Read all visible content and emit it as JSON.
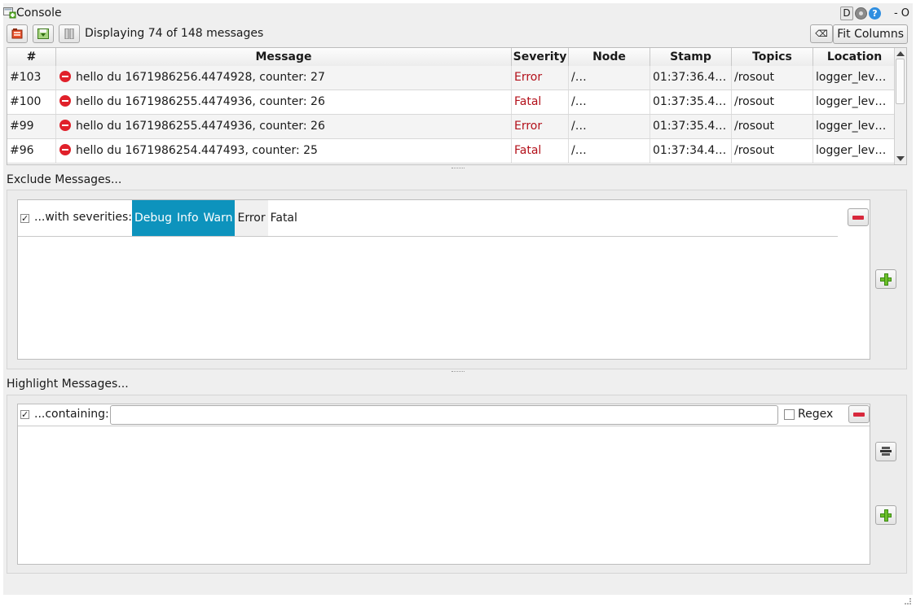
{
  "window": {
    "title": "Console",
    "title_buttons": {
      "d_label": "D",
      "help_label": "?",
      "controls_text": "- O"
    }
  },
  "toolbar": {
    "status": "Displaying 74 of 148 messages",
    "fit_columns_label": "Fit Columns",
    "clear_label": "⌫"
  },
  "table": {
    "columns": [
      "#",
      "Message",
      "Severity",
      "Node",
      "Stamp",
      "Topics",
      "Location"
    ],
    "rows": [
      {
        "num": "#103",
        "message": "hello du 1671986256.4474928, counter: 27",
        "severity": "Error",
        "node": "/…",
        "stamp": "01:37:36.4…",
        "topics": "/rosout",
        "location": "logger_lev…"
      },
      {
        "num": "#100",
        "message": "hello du 1671986255.4474936, counter: 26",
        "severity": "Fatal",
        "node": "/…",
        "stamp": "01:37:35.4…",
        "topics": "/rosout",
        "location": "logger_lev…"
      },
      {
        "num": "#99",
        "message": "hello du 1671986255.4474936, counter: 26",
        "severity": "Error",
        "node": "/…",
        "stamp": "01:37:35.4…",
        "topics": "/rosout",
        "location": "logger_lev…"
      },
      {
        "num": "#96",
        "message": "hello du 1671986254.447493, counter: 25",
        "severity": "Fatal",
        "node": "/…",
        "stamp": "01:37:34.4…",
        "topics": "/rosout",
        "location": "logger_lev…"
      }
    ]
  },
  "exclude": {
    "title": "Exclude Messages...",
    "filter": {
      "checked": true,
      "label": "...with severities:",
      "severities": [
        {
          "name": "Debug",
          "selected": true
        },
        {
          "name": "Info",
          "selected": true
        },
        {
          "name": "Warn",
          "selected": true
        },
        {
          "name": "Error",
          "selected": false
        },
        {
          "name": "Fatal",
          "selected": false
        }
      ]
    }
  },
  "highlight": {
    "title": "Highlight Messages...",
    "filter": {
      "checked": true,
      "label": "...containing:",
      "value": "",
      "regex_label": "Regex",
      "regex_checked": false
    }
  },
  "colors": {
    "selection": "#0d93bd",
    "severity_text": "#b3101a",
    "remove": "#d8283c",
    "add": "#6cbf2a"
  }
}
